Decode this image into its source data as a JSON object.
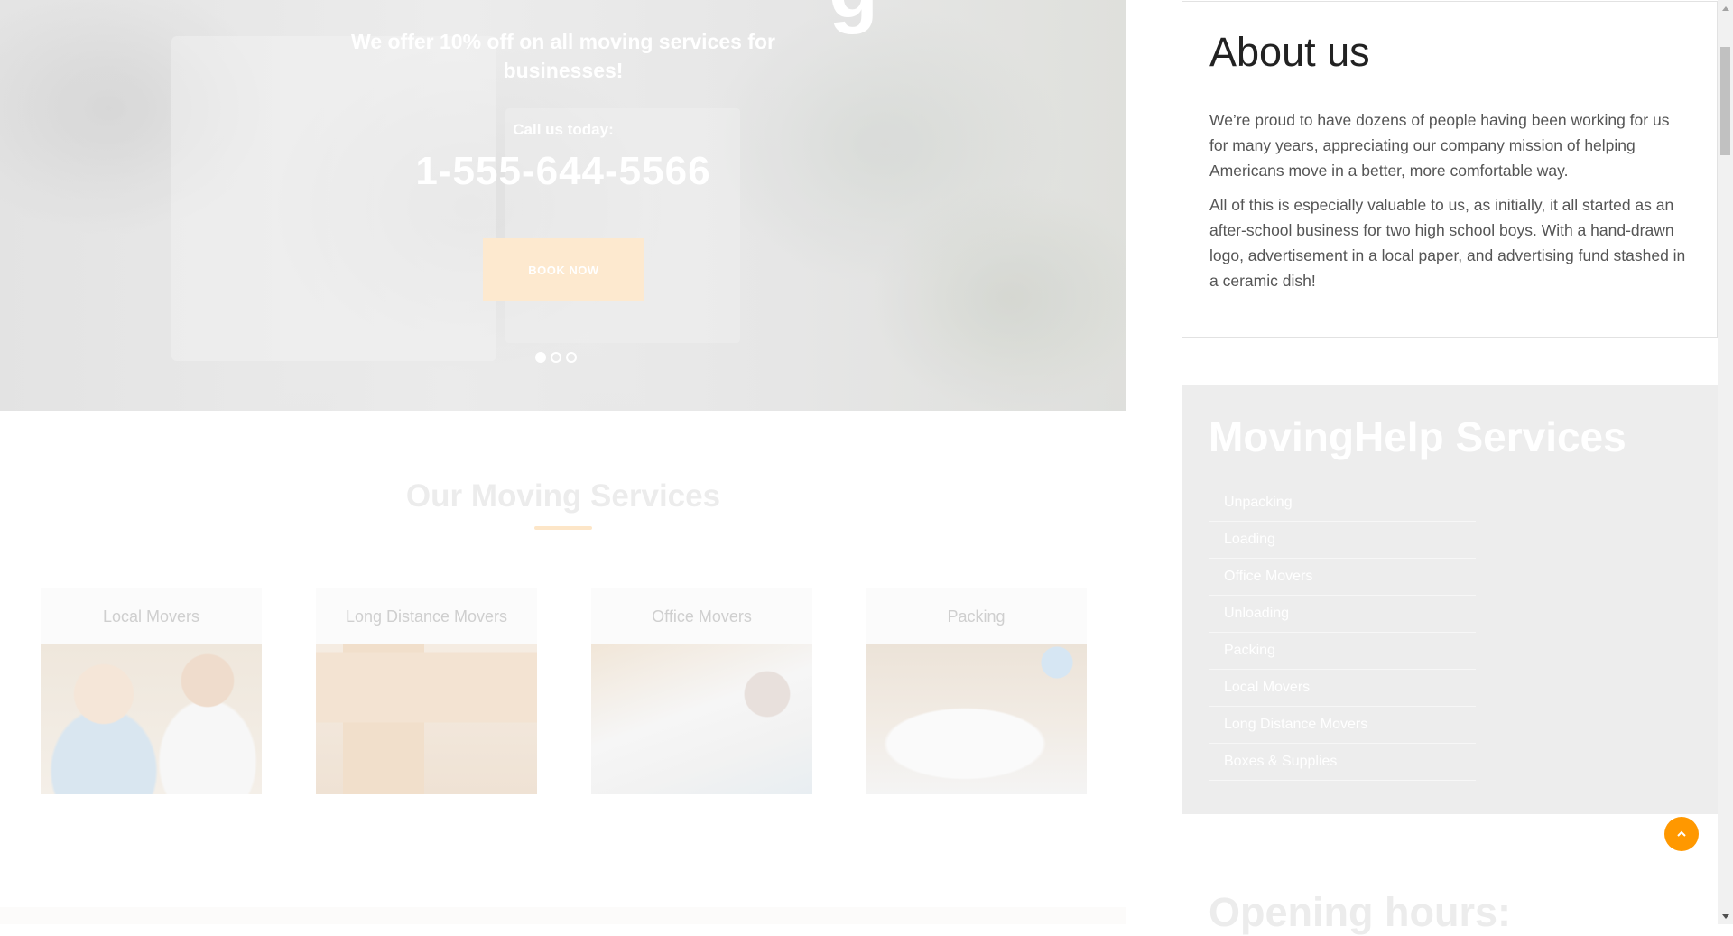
{
  "hero": {
    "heading_fragment": "g",
    "offer": "We offer 10% off on all moving services for businesses!",
    "call_label": "Call us today:",
    "phone": "1-555-644-5566",
    "book_button": "BOOK NOW",
    "slides_total": 3,
    "slide_active": 1
  },
  "services": {
    "title": "Our Moving Services",
    "cards": [
      {
        "title": "Local Movers"
      },
      {
        "title": "Long Distance Movers"
      },
      {
        "title": "Office Movers"
      },
      {
        "title": "Packing"
      }
    ]
  },
  "about": {
    "title": "About us",
    "p1": "We’re proud to have dozens of people having been working for us for many years, appreciating our company mission of helping Americans move in a better, more comfortable way.",
    "p2": "All of this is especially valuable to us, as initially, it all started as an after-school business for two high school boys. With a hand-drawn logo, advertisement in a local paper, and advertising fund stashed in a ceramic dish!"
  },
  "sidebar_services": {
    "title": "MovingHelp Services",
    "items": [
      "Unpacking",
      "Loading",
      "Office Movers",
      "Unloading",
      "Packing",
      "Local Movers",
      "Long Distance Movers",
      "Boxes & Supplies"
    ]
  },
  "hours": {
    "title": "Opening hours:"
  },
  "colors": {
    "accent": "#ff9800",
    "button_tint": "#fde9cf"
  }
}
